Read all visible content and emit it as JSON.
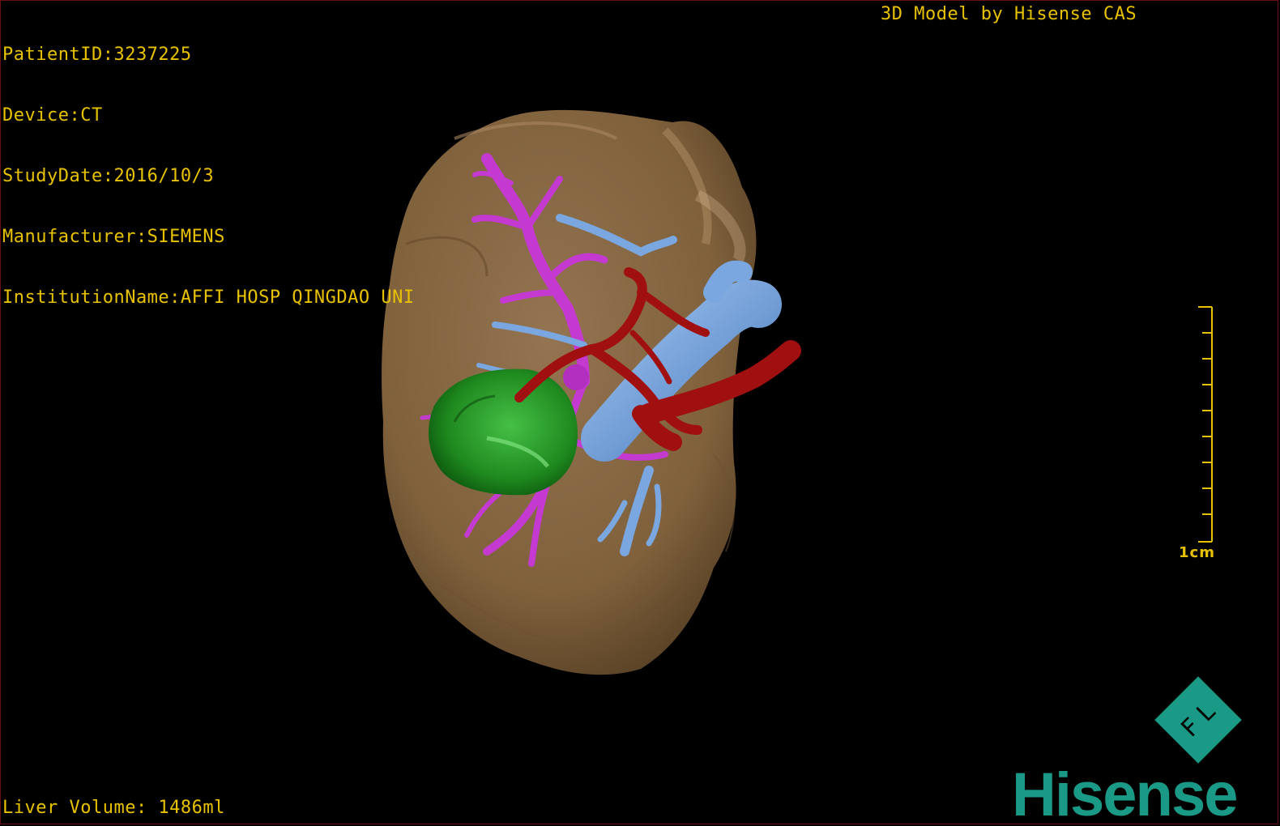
{
  "meta": {
    "patient_id": "PatientID:3237225",
    "device": "Device:CT",
    "study_date": "StudyDate:2016/10/3",
    "manufacturer": "Manufacturer:SIEMENS",
    "institution": "InstitutionName:AFFI HOSP QINGDAO UNI"
  },
  "credit": "3D Model by Hisense CAS",
  "liver_volume": "Liver Volume: 1486ml",
  "scale_label": "1cm",
  "brand": {
    "logo_text": "Hisense",
    "badge_text": "F L"
  },
  "colors": {
    "overlay_text": "#e8c200",
    "liver": "#8a6a48",
    "tumor": "#1f8a1f",
    "portal_vein": "#6f9ed8",
    "hepatic_vein": "#c43ad0",
    "artery": "#a01010",
    "brand": "#1a9a86"
  },
  "legend_structures": [
    "liver",
    "tumor",
    "portal-vein",
    "hepatic-vein",
    "hepatic-artery"
  ]
}
